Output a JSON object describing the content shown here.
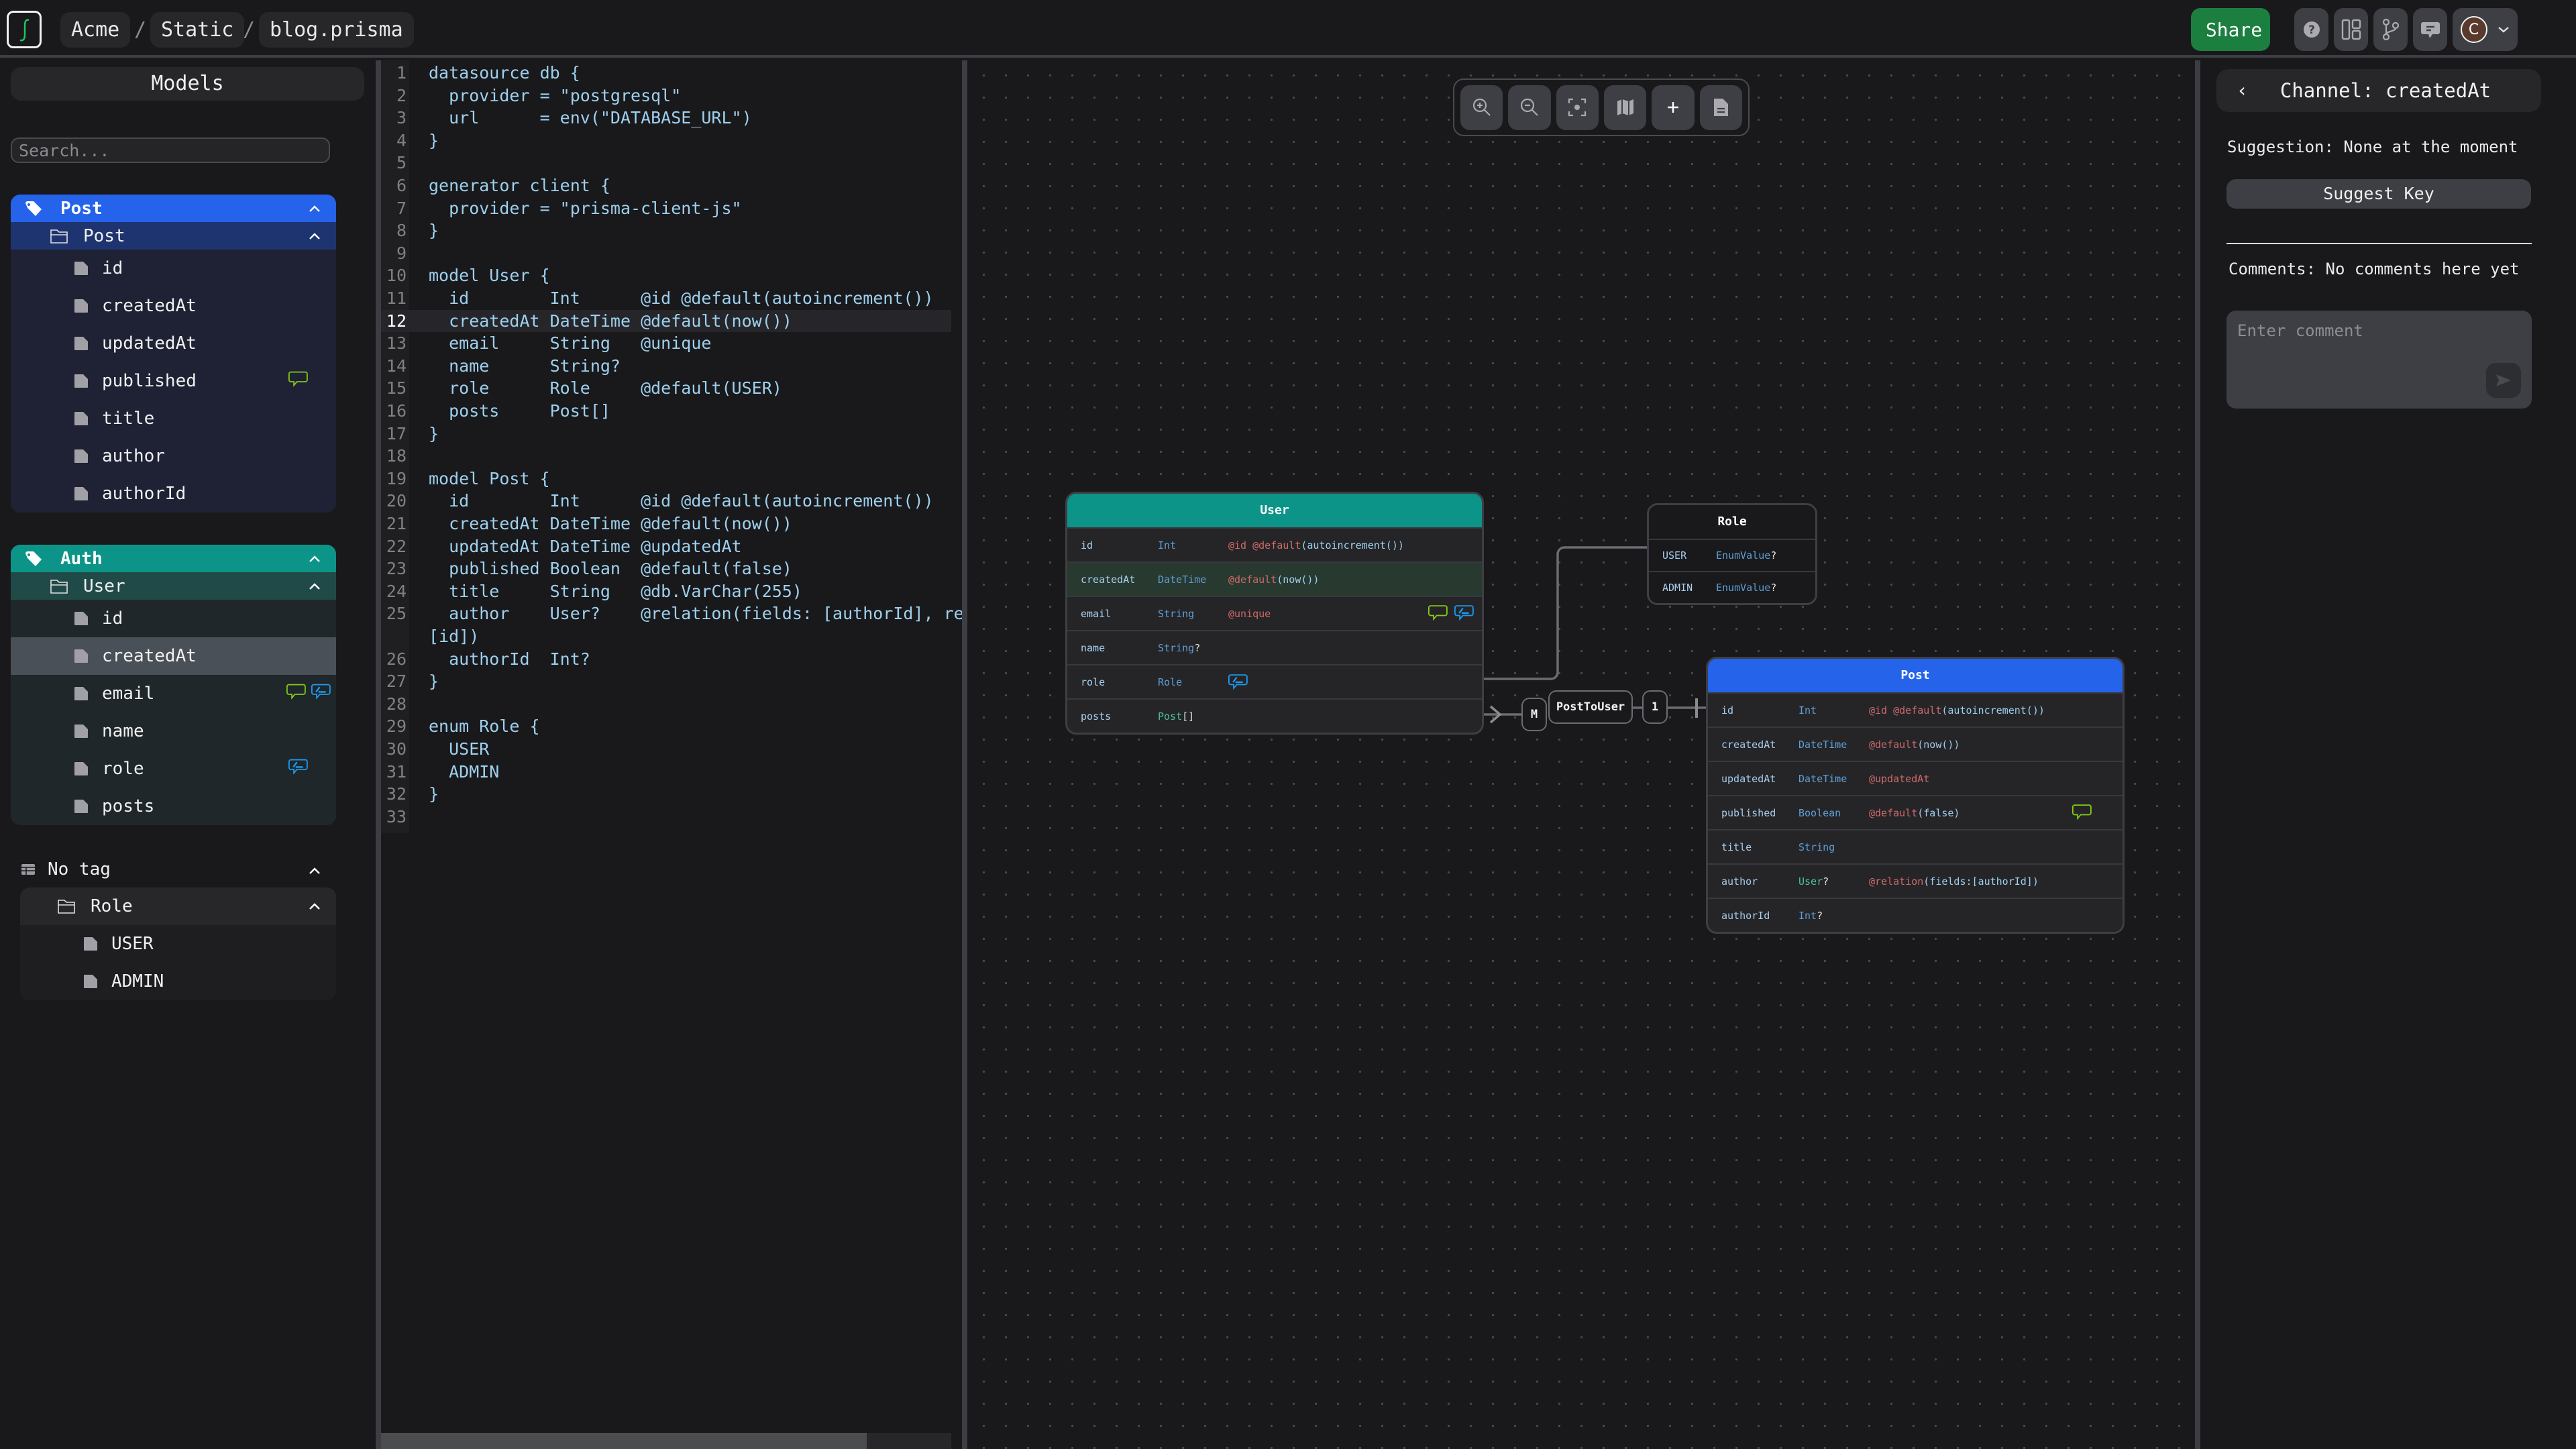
{
  "topbar": {
    "breadcrumbs": [
      "Acme",
      "Static",
      "blog.prisma"
    ],
    "separator": "/",
    "share_label": "Share",
    "avatar_initial": "C",
    "colors": {
      "share": "#1b7f3f",
      "avatar": "#5b3a2e"
    }
  },
  "sidebar": {
    "title": "Models",
    "search_placeholder": "Search...",
    "groups": [
      {
        "tag": "Post",
        "color": "#2563eb",
        "model": "Post",
        "fields": [
          {
            "name": "id",
            "badges": []
          },
          {
            "name": "createdAt",
            "badges": []
          },
          {
            "name": "updatedAt",
            "badges": []
          },
          {
            "name": "published",
            "badges": [
              "comment"
            ]
          },
          {
            "name": "title",
            "badges": []
          },
          {
            "name": "author",
            "badges": []
          },
          {
            "name": "authorId",
            "badges": []
          }
        ]
      },
      {
        "tag": "Auth",
        "color": "#0d9488",
        "model": "User",
        "fields": [
          {
            "name": "id",
            "badges": []
          },
          {
            "name": "createdAt",
            "badges": [],
            "selected": true
          },
          {
            "name": "email",
            "badges": [
              "comment",
              "suggestion"
            ]
          },
          {
            "name": "name",
            "badges": []
          },
          {
            "name": "role",
            "badges": [
              "suggestion"
            ]
          },
          {
            "name": "posts",
            "badges": []
          }
        ]
      },
      {
        "tag": "No tag",
        "model": "Role",
        "fields": [
          {
            "name": "USER",
            "badges": []
          },
          {
            "name": "ADMIN",
            "badges": []
          }
        ]
      }
    ]
  },
  "editor": {
    "active_line": 12,
    "lines": [
      "datasource db {",
      "  provider = \"postgresql\"",
      "  url      = env(\"DATABASE_URL\")",
      "}",
      "",
      "generator client {",
      "  provider = \"prisma-client-js\"",
      "}",
      "",
      "model User {",
      "  id        Int      @id @default(autoincrement())",
      "  createdAt DateTime @default(now())",
      "  email     String   @unique",
      "  name      String?",
      "  role      Role     @default(USER)",
      "  posts     Post[]",
      "}",
      "",
      "model Post {",
      "  id        Int      @id @default(autoincrement())",
      "  createdAt DateTime @default(now())",
      "  updatedAt DateTime @updatedAt",
      "  published Boolean  @default(false)",
      "  title     String   @db.VarChar(255)",
      "  author    User?    @relation(fields: [authorId], ref",
      "[id])",
      "  authorId  Int?",
      "}",
      "",
      "enum Role {",
      "  USER",
      "  ADMIN",
      "}",
      ""
    ],
    "line_numbers": [
      "1",
      "2",
      "3",
      "4",
      "5",
      "6",
      "7",
      "8",
      "9",
      "10",
      "11",
      "12",
      "13",
      "14",
      "15",
      "16",
      "17",
      "18",
      "19",
      "20",
      "21",
      "22",
      "23",
      "24",
      "25",
      "",
      "26",
      "27",
      "28",
      "29",
      "30",
      "31",
      "32",
      "33"
    ]
  },
  "canvas": {
    "toolbar": [
      "zoom-in",
      "zoom-out",
      "fit-view",
      "minimap",
      "add",
      "document"
    ],
    "nodes": {
      "user": {
        "title": "User",
        "color": "#0d9488",
        "rows": [
          {
            "name": "id",
            "type": "Int",
            "attr_kw": "@id @default",
            "attr_args": "(autoincrement())",
            "badges": []
          },
          {
            "name": "createdAt",
            "type": "DateTime",
            "attr_kw": "@default",
            "attr_args": "(now())",
            "badges": [],
            "highlight": true
          },
          {
            "name": "email",
            "type": "String",
            "attr_kw": "@unique",
            "attr_args": "",
            "badges": [
              "comment",
              "suggestion"
            ]
          },
          {
            "name": "name",
            "type": "String",
            "type_suffix": "?",
            "attr_kw": "",
            "attr_args": "",
            "badges": []
          },
          {
            "name": "role",
            "type": "Role",
            "attr_kw": "",
            "attr_args": "",
            "badges": [
              "suggestion-inline"
            ]
          },
          {
            "name": "posts",
            "type": "Post",
            "type_suffix": "[]",
            "relation": true,
            "attr_kw": "",
            "attr_args": "",
            "badges": []
          }
        ]
      },
      "role": {
        "title": "Role",
        "rows": [
          {
            "name": "USER",
            "type": "EnumValue",
            "type_suffix": "?"
          },
          {
            "name": "ADMIN",
            "type": "EnumValue",
            "type_suffix": "?"
          }
        ]
      },
      "post": {
        "title": "Post",
        "color": "#2563eb",
        "rows": [
          {
            "name": "id",
            "type": "Int",
            "attr_kw": "@id @default",
            "attr_args": "(autoincrement())",
            "badges": []
          },
          {
            "name": "createdAt",
            "type": "DateTime",
            "attr_kw": "@default",
            "attr_args": "(now())",
            "badges": []
          },
          {
            "name": "updatedAt",
            "type": "DateTime",
            "attr_kw": "@updatedAt",
            "attr_args": "",
            "badges": []
          },
          {
            "name": "published",
            "type": "Boolean",
            "attr_kw": "@default",
            "attr_args": "(false)",
            "badges": [
              "comment"
            ]
          },
          {
            "name": "title",
            "type": "String",
            "attr_kw": "",
            "attr_args": "",
            "badges": []
          },
          {
            "name": "author",
            "type": "User",
            "type_suffix": "?",
            "relation": true,
            "attr_kw": "@relation",
            "attr_args": "(fields:[authorId])",
            "badges": []
          },
          {
            "name": "authorId",
            "type": "Int",
            "type_suffix": "?",
            "attr_kw": "",
            "attr_args": "",
            "badges": []
          }
        ]
      }
    },
    "edges": {
      "relation_name": "PostToUser",
      "many_label": "M",
      "one_label": "1"
    }
  },
  "right_panel": {
    "channel_title": "Channel: createdAt",
    "suggestion_text": "Suggestion: None at the moment",
    "suggest_button": "Suggest Key",
    "comments_text": "Comments: No comments here yet",
    "comment_placeholder": "Enter comment"
  }
}
